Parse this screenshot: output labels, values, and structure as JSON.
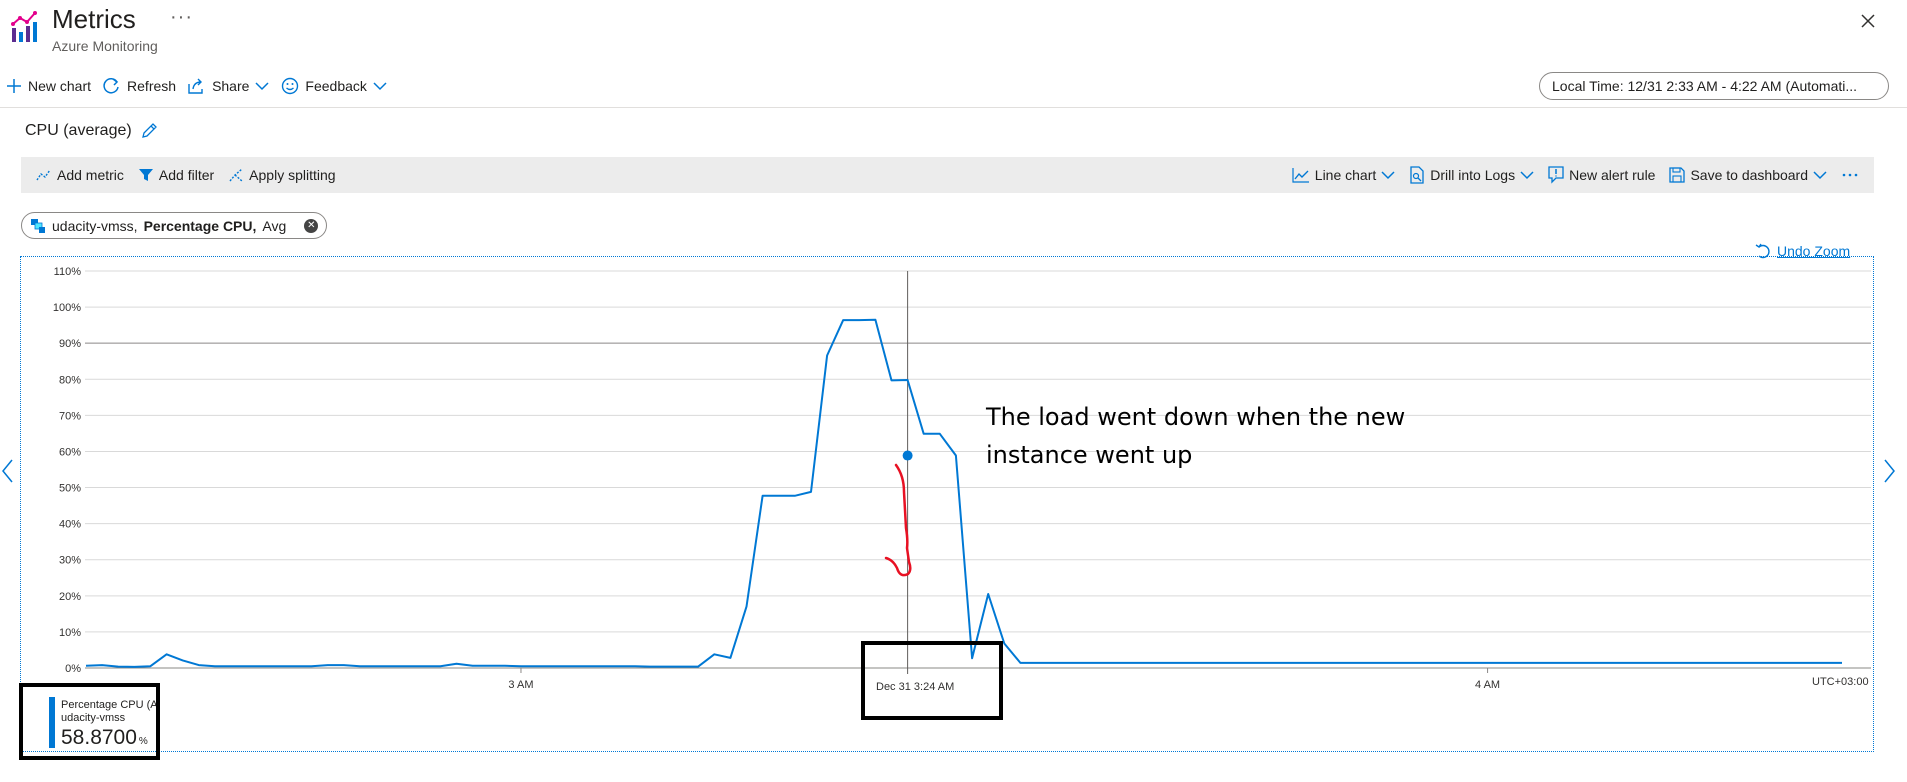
{
  "header": {
    "title": "Metrics",
    "more": "···",
    "subtitle": "Azure Monitoring"
  },
  "commands": {
    "new_chart": "New chart",
    "refresh": "Refresh",
    "share": "Share",
    "feedback": "Feedback",
    "time_range": "Local Time: 12/31 2:33 AM - 4:22 AM (Automati..."
  },
  "chart_title": "CPU (average)",
  "toolbar": {
    "add_metric": "Add metric",
    "add_filter": "Add filter",
    "apply_splitting": "Apply splitting",
    "line_chart": "Line chart",
    "drill_into_logs": "Drill into Logs",
    "new_alert_rule": "New alert rule",
    "save_to_dashboard": "Save to dashboard"
  },
  "metric_pill": {
    "resource": "udacity-vmss,",
    "metric": "Percentage CPU,",
    "aggregation": "Avg"
  },
  "undo_zoom": "Undo Zoom",
  "annotation": "The load went down when the new instance went up",
  "cursor_label": "Dec 31 3:24 AM",
  "timezone": "UTC+03:00",
  "legend": {
    "name": "Percentage CPU (Avg)",
    "resource": "udacity-vmss",
    "value": "58.8700",
    "unit": "%"
  },
  "colors": {
    "accent": "#0078d4",
    "series": "#0078d4",
    "annotation_stroke": "#e81123"
  },
  "chart_data": {
    "type": "line",
    "y_unit": "%",
    "ylim": [
      0,
      110
    ],
    "y_ticks": [
      "0%",
      "10%",
      "20%",
      "30%",
      "40%",
      "50%",
      "60%",
      "70%",
      "80%",
      "90%",
      "100%",
      "110%"
    ],
    "x_tick_labels": [
      "3 AM",
      "4 AM"
    ],
    "xlim": [
      "2:33 AM",
      "4:22 AM"
    ],
    "grid": true,
    "series": [
      {
        "name": "Percentage CPU (Avg)",
        "x": [
          "2:33",
          "2:34",
          "2:35",
          "2:36",
          "2:37",
          "2:38",
          "2:39",
          "2:40",
          "2:41",
          "2:42",
          "2:43",
          "2:44",
          "2:45",
          "2:46",
          "2:47",
          "2:48",
          "2:49",
          "2:50",
          "2:51",
          "2:52",
          "2:53",
          "2:54",
          "2:55",
          "2:56",
          "2:57",
          "2:58",
          "2:59",
          "3:00",
          "3:01",
          "3:02",
          "3:03",
          "3:04",
          "3:05",
          "3:06",
          "3:07",
          "3:08",
          "3:09",
          "3:10",
          "3:11",
          "3:12",
          "3:13",
          "3:14",
          "3:15",
          "3:16",
          "3:17",
          "3:18",
          "3:19",
          "3:20",
          "3:21",
          "3:22",
          "3:23",
          "3:24",
          "3:25",
          "3:26",
          "3:27",
          "3:28",
          "3:29",
          "3:30",
          "3:31",
          "3:32",
          "3:33",
          "3:34",
          "3:35",
          "3:36",
          "3:37",
          "3:38",
          "3:39",
          "3:40",
          "3:41",
          "3:42",
          "3:43",
          "3:44",
          "3:45",
          "3:46",
          "3:47",
          "3:48",
          "3:49",
          "3:50",
          "3:51",
          "3:52",
          "3:53",
          "3:54",
          "3:55",
          "3:56",
          "3:57",
          "3:58",
          "3:59",
          "4:00",
          "4:01",
          "4:02",
          "4:03",
          "4:04",
          "4:05",
          "4:06",
          "4:07",
          "4:08",
          "4:09",
          "4:10",
          "4:11",
          "4:12",
          "4:13",
          "4:14",
          "4:15",
          "4:16",
          "4:17",
          "4:18",
          "4:19",
          "4:20",
          "4:21",
          "4:22"
        ],
        "values": [
          0.6,
          0.8,
          0.4,
          0.3,
          0.5,
          3.8,
          2.1,
          0.8,
          0.5,
          0.5,
          0.5,
          0.5,
          0.5,
          0.5,
          0.5,
          0.8,
          0.8,
          0.5,
          0.5,
          0.5,
          0.5,
          0.5,
          0.5,
          1.2,
          0.6,
          0.6,
          0.6,
          0.5,
          0.5,
          0.5,
          0.5,
          0.5,
          0.5,
          0.5,
          0.5,
          0.4,
          0.4,
          0.4,
          0.4,
          3.8,
          2.8,
          17.0,
          47.7,
          47.7,
          47.7,
          48.8,
          86.6,
          96.4,
          96.4,
          96.5,
          79.7,
          79.8,
          64.9,
          64.9,
          58.87,
          2.7,
          20.5,
          6.8,
          1.4,
          1.4,
          1.4,
          1.4,
          1.4,
          1.4,
          1.4,
          1.4,
          1.4,
          1.4,
          1.4,
          1.4,
          1.4,
          1.4,
          1.4,
          1.4,
          1.4,
          1.4,
          1.4,
          1.4,
          1.4,
          1.4,
          1.4,
          1.4,
          1.4,
          1.4,
          1.4,
          1.4,
          1.4,
          1.4,
          1.4,
          1.4,
          1.4,
          1.4,
          1.4,
          1.4,
          1.4,
          1.4,
          1.4,
          1.4,
          1.4,
          1.4,
          1.4,
          1.4,
          1.4,
          1.4,
          1.4,
          1.4,
          1.4,
          1.4,
          1.4,
          1.4
        ]
      }
    ],
    "highlighted_point": {
      "x": "3:24",
      "y": 58.87
    }
  }
}
